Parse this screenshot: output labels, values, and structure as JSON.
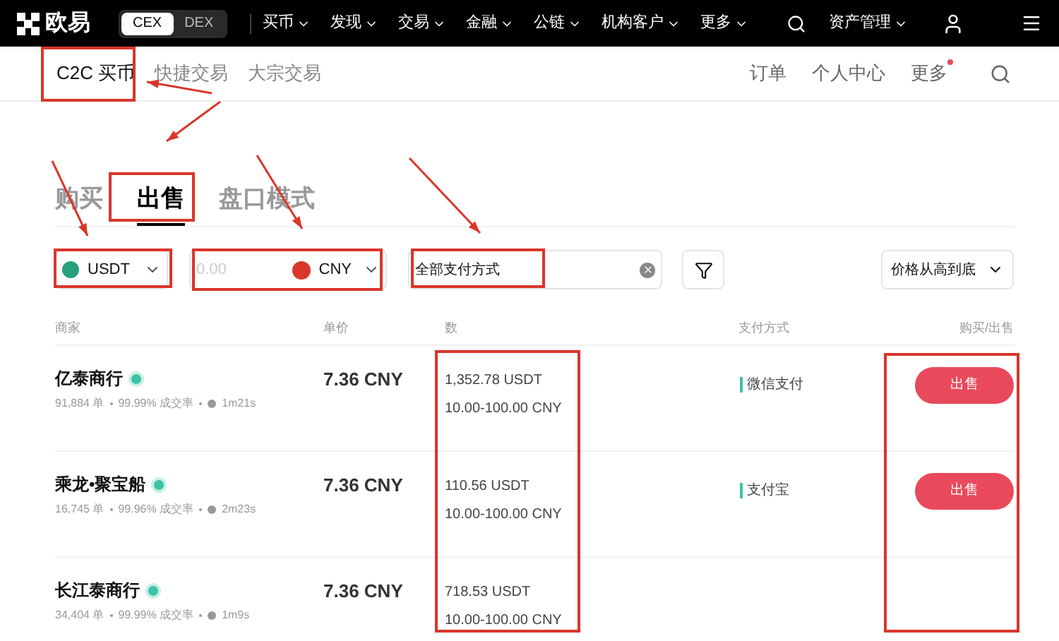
{
  "topbar": {
    "logo": "欧易",
    "switch": [
      {
        "label": "CEX",
        "selected": true
      },
      {
        "label": "DEX",
        "selected": false
      }
    ],
    "menu": [
      "买币",
      "发现",
      "交易",
      "金融",
      "公链",
      "机构客户",
      "更多"
    ],
    "assets": "资产管理"
  },
  "subnav": {
    "left": [
      {
        "label": "C2C 买币",
        "selected": true
      },
      {
        "label": "快捷交易",
        "selected": false
      },
      {
        "label": "大宗交易",
        "selected": false
      }
    ],
    "right": [
      {
        "label": "订单",
        "notification": false
      },
      {
        "label": "个人中心",
        "notification": false
      },
      {
        "label": "更多",
        "notification": true
      }
    ]
  },
  "tabs": [
    {
      "label": "购买",
      "selected": false
    },
    {
      "label": "出售",
      "selected": true
    },
    {
      "label": "盘口模式",
      "selected": false
    }
  ],
  "filters": {
    "crypto": "USDT",
    "amount_placeholder": "0.00",
    "fiat": "CNY",
    "payment": "全部支付方式",
    "sort": "价格从高到底"
  },
  "columns": [
    "商家",
    "单价",
    "数",
    "支付方式",
    "购买/出售"
  ],
  "rows": [
    {
      "name": "亿泰商行",
      "orders": "91,884 单",
      "rate": "99.99% 成交率",
      "time": "1m21s",
      "price": "7.36 CNY",
      "amount": "1,352.78 USDT",
      "limit": "10.00-100.00 CNY",
      "payment": "微信支付",
      "action": "出售"
    },
    {
      "name": "乘龙•聚宝船",
      "orders": "16,745 单",
      "rate": "99.96% 成交率",
      "time": "2m23s",
      "price": "7.36 CNY",
      "amount": "110.56 USDT",
      "limit": "10.00-100.00 CNY",
      "payment": "支付宝",
      "action": "出售"
    },
    {
      "name": "长江泰商行",
      "orders": "34,404 单",
      "rate": "99.99% 成交率",
      "time": "1m9s",
      "price": "7.36 CNY",
      "amount": "718.53 USDT",
      "limit": "10.00-100.00 CNY"
    }
  ]
}
